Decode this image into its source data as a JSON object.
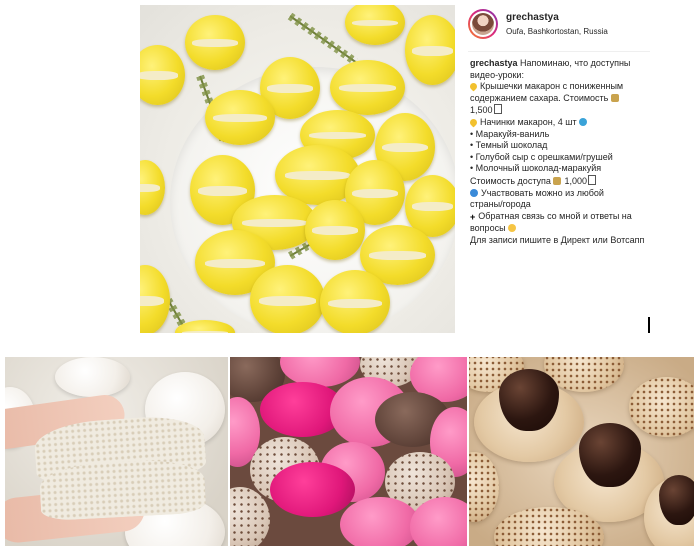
{
  "profile": {
    "username": "grechastya",
    "location": "Oufa, Bashkortostan, Russia",
    "avatar_icon": "avatar-photo"
  },
  "caption": {
    "user": "grechastya",
    "intro": "Напоминаю, что доступны",
    "line2": "видео-уроки:",
    "item1a": "Крышечки макарон с пониженным",
    "item1b": "содержанием сахара. Стоимость",
    "item1c": "1,500",
    "item2": "Начинки макарон, 4 шт",
    "flavors": [
      "• Маракуйя-ваниль",
      "• Темный шоколад",
      "• Голубой сыр с орешками/грушей",
      "• Молочный шоколад-маракуйя"
    ],
    "price2a": "Стоимость доступа",
    "price2b": "1,000",
    "world1": "Участвовать можно из любой",
    "world2": "страны/города",
    "feedback1": "Обратная связь со мной и ответы на",
    "feedback2": "вопросы",
    "contact": "Для записи пишите в Директ или Вотсапп",
    "plus_symbol": "+"
  },
  "icons": [
    "heart-icon",
    "money-bag-icon",
    "info-icon",
    "globe-icon",
    "plus-icon",
    "smile-icon"
  ],
  "colors": {
    "macaron_yellow": "#f3dc2a",
    "pink": "#f06aa6",
    "magenta": "#e0177a",
    "chocolate": "#2c1610",
    "caption_text": "#262626"
  },
  "photos": [
    "yellow-macarons-photo",
    "meringue-cookie-photo",
    "pink-macarons-photo",
    "chocolate-kiss-cookies-photo"
  ]
}
